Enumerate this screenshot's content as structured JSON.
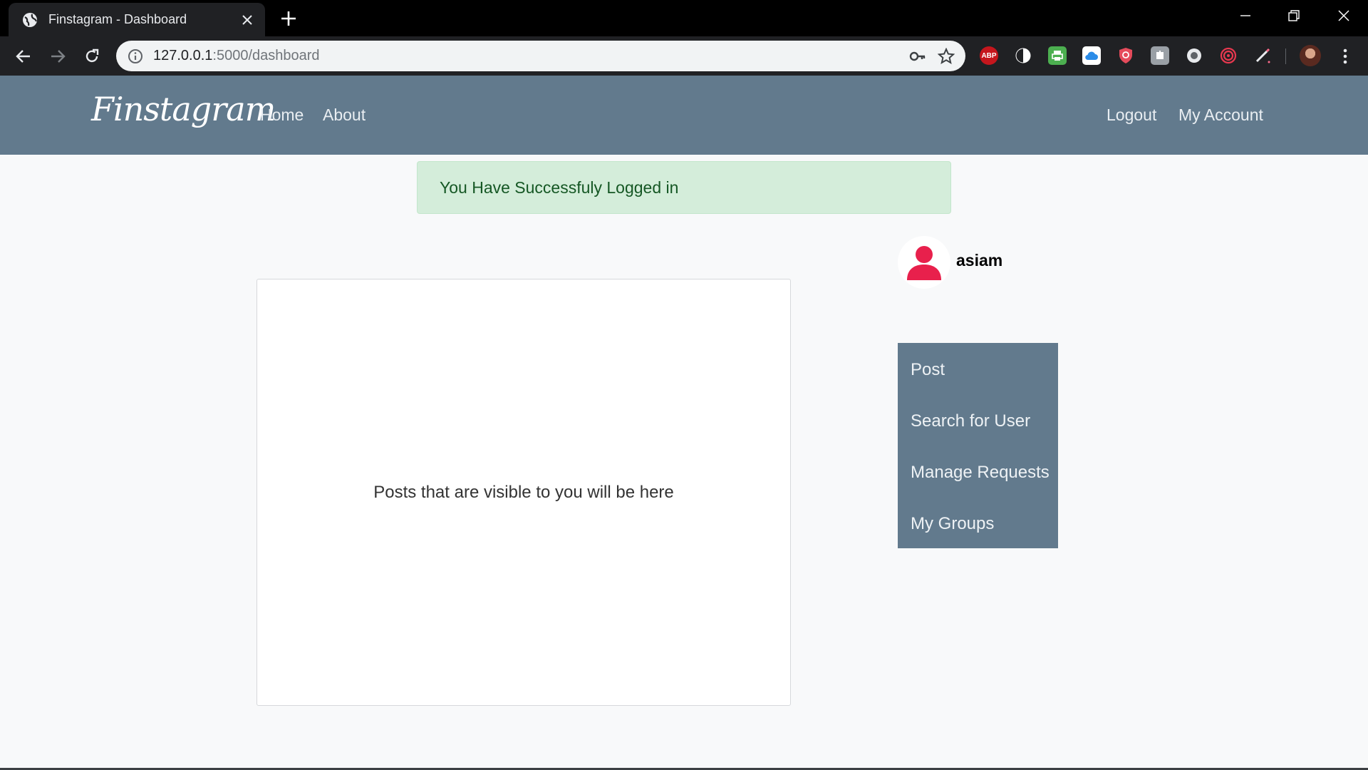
{
  "browser": {
    "tab_title": "Finstagram - Dashboard",
    "url_host": "127.0.0.1",
    "url_path": ":5000/dashboard",
    "extensions": [
      "abp-icon",
      "dark-reader-icon",
      "printer-icon",
      "cloud-icon",
      "shield-icon",
      "extension-icon",
      "circle-icon",
      "spiral-icon",
      "pen-icon"
    ],
    "extension_labels": {
      "abp": "ABP"
    }
  },
  "navbar": {
    "brand": "Finstagram",
    "links": [
      "Home",
      "About"
    ],
    "right_links": [
      "Logout",
      "My Account"
    ]
  },
  "alert": {
    "message": "You Have Successfuly Logged in"
  },
  "feed": {
    "placeholder": "Posts that are visible to you will be here"
  },
  "profile": {
    "username": "asiam"
  },
  "sidebar": {
    "items": [
      "Post",
      "Search for User",
      "Manage Requests",
      "My Groups"
    ]
  },
  "colors": {
    "navbar": "#627a8d",
    "alert_bg": "#d4edda",
    "alert_text": "#155724",
    "avatar_accent": "#e8204c"
  }
}
